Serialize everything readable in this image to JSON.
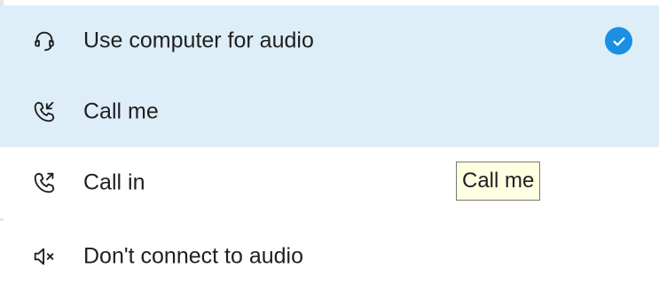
{
  "menu": {
    "items": [
      {
        "label": "Use computer for audio",
        "icon": "headset-icon",
        "selected": true,
        "hovered": false
      },
      {
        "label": "Call me",
        "icon": "call-me-icon",
        "selected": false,
        "hovered": true
      },
      {
        "label": "Call in",
        "icon": "call-in-icon",
        "selected": false,
        "hovered": false
      },
      {
        "label": "Don't connect to audio",
        "icon": "speaker-mute-icon",
        "selected": false,
        "hovered": false
      }
    ]
  },
  "tooltip": {
    "text": "Call me"
  },
  "colors": {
    "highlight_bg": "#deeef8",
    "check_accent": "#1a8fe3",
    "text": "#1f1f1f",
    "tooltip_bg": "#ffffe1"
  }
}
